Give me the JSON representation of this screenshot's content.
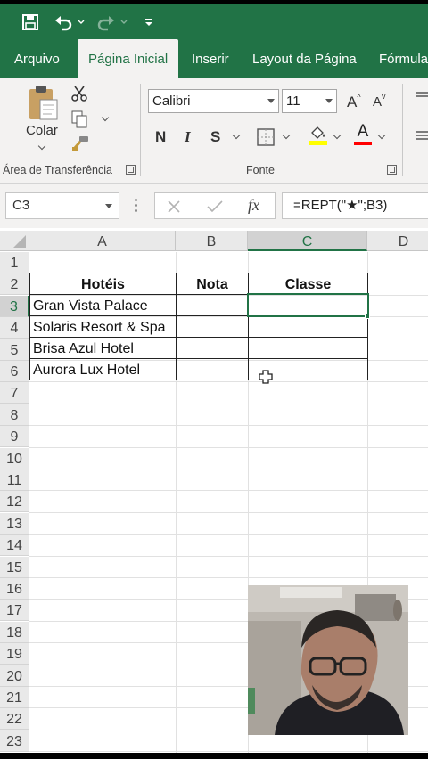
{
  "quick_access": {
    "save_icon": "save-icon",
    "undo_icon": "undo-icon",
    "redo_icon": "redo-icon",
    "customize_icon": "customize-qat-icon"
  },
  "tabs": [
    {
      "label": "Arquivo",
      "active": false
    },
    {
      "label": "Página Inicial",
      "active": true
    },
    {
      "label": "Inserir",
      "active": false
    },
    {
      "label": "Layout da Página",
      "active": false
    },
    {
      "label": "Fórmula",
      "active": false
    }
  ],
  "ribbon": {
    "clipboard": {
      "paste_label": "Colar",
      "group_label": "Área de Transferência"
    },
    "font": {
      "font_name": "Calibri",
      "font_size": "11",
      "bold": "N",
      "italic": "I",
      "underline": "S",
      "grow_label": "A",
      "shrink_label": "A",
      "color_label": "A",
      "fill_color": "#ffff00",
      "font_color": "#ff0000",
      "group_label": "Fonte"
    }
  },
  "formula_bar": {
    "name_box": "C3",
    "formula": "=REPT(\"★\";B3)"
  },
  "sheet": {
    "columns": [
      {
        "label": "A",
        "selected": false
      },
      {
        "label": "B",
        "selected": false
      },
      {
        "label": "C",
        "selected": true
      },
      {
        "label": "D",
        "selected": false
      }
    ],
    "rows": [
      "1",
      "2",
      "3",
      "4",
      "5",
      "6",
      "7",
      "8",
      "9",
      "10",
      "11",
      "12",
      "13",
      "14",
      "15",
      "16",
      "17",
      "18",
      "19",
      "20",
      "21",
      "22",
      "23"
    ],
    "selected_row": "3",
    "headers": {
      "a": "Hotéis",
      "b": "Nota",
      "c": "Classe"
    },
    "hotels": [
      "Gran Vista Palace",
      "Solaris Resort & Spa",
      "Brisa Azul Hotel",
      "Aurora Lux Hotel"
    ],
    "active_cell": "C3"
  },
  "colors": {
    "excel_green": "#217346",
    "ribbon_bg": "#f3f2f1",
    "grid_line": "#e1e1e1"
  }
}
